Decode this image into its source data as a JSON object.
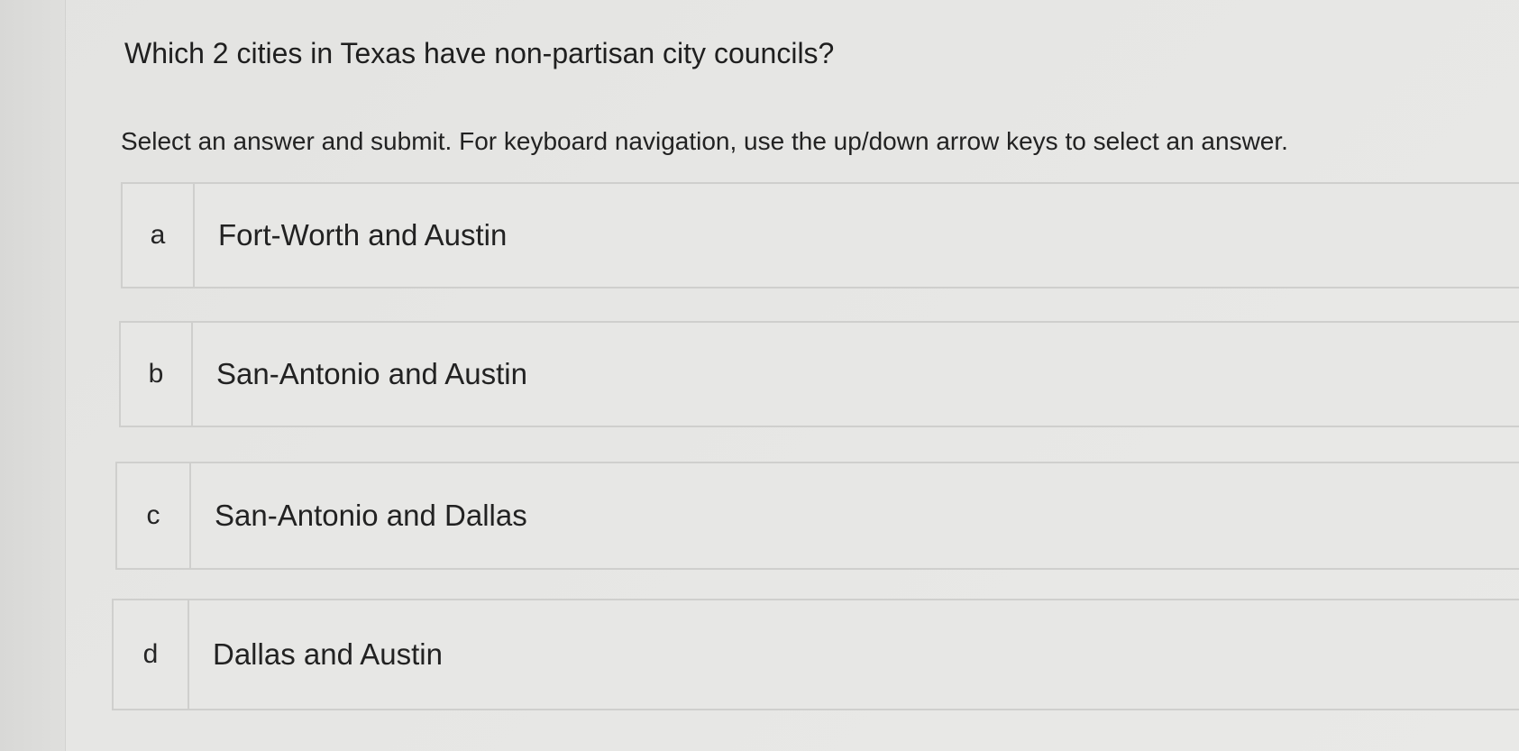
{
  "question": "Which 2 cities in Texas have non-partisan city councils?",
  "instructions": "Select an answer and submit. For keyboard navigation, use the up/down arrow keys to select an answer.",
  "choices": [
    {
      "letter": "a",
      "text": "Fort-Worth and Austin"
    },
    {
      "letter": "b",
      "text": "San-Antonio and Austin"
    },
    {
      "letter": "c",
      "text": "San-Antonio and Dallas"
    },
    {
      "letter": "d",
      "text": "Dallas and Austin"
    }
  ]
}
